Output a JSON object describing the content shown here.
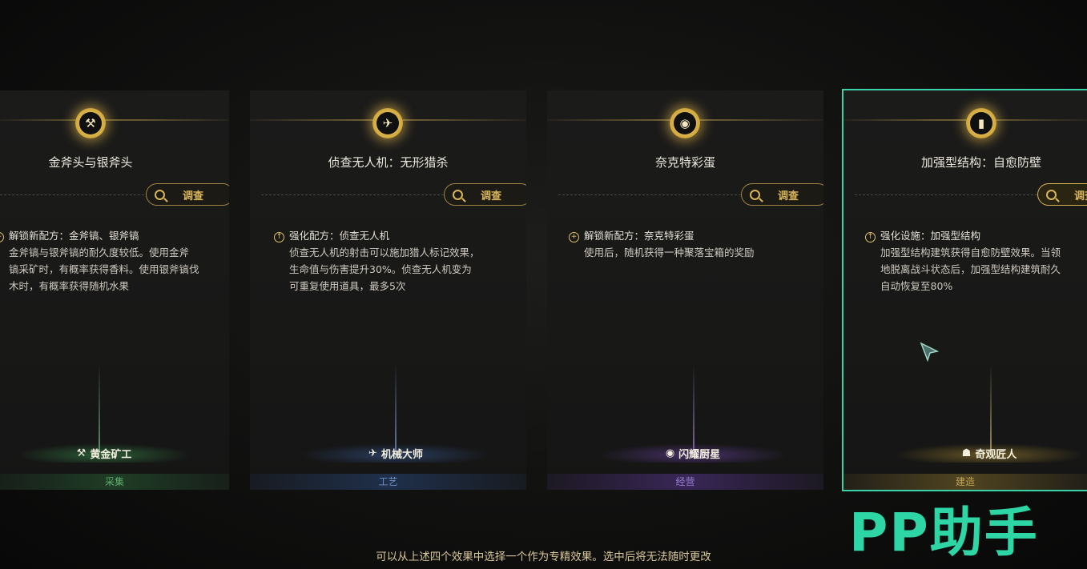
{
  "cards": [
    {
      "title": "金斧头与银斧头",
      "investigate_label": "调查",
      "effect_icon": "plus-circle-icon",
      "desc_lines": [
        "解锁新配方：金斧镐、银斧镐",
        "金斧镐与银斧镐的耐久度较低。使用金斧",
        "镐采矿时，有概率获得香料。使用银斧镐伐",
        "木时，有概率获得随机水果"
      ],
      "badge_icon": "pickaxe-icon",
      "badge": "黄金矿工",
      "category": "采集",
      "accent": "#3e8f4a"
    },
    {
      "title": "侦查无人机：无形猎杀",
      "investigate_label": "调查",
      "effect_icon": "upgrade-icon",
      "desc_lines": [
        "强化配方：侦查无人机",
        "侦查无人机的射击可以施加猎人标记效果，",
        "生命值与伤害提升30%。侦查无人机变为",
        "可重复使用道具，最多5次"
      ],
      "badge_icon": "drone-icon",
      "badge": "机械大师",
      "category": "工艺",
      "accent": "#3a5f9a"
    },
    {
      "title": "奈克特彩蛋",
      "investigate_label": "调查",
      "effect_icon": "plus-circle-icon",
      "desc_lines": [
        "解锁新配方：奈克特彩蛋",
        "使用后，随机获得一种聚落宝箱的奖励"
      ],
      "badge_icon": "dish-icon",
      "badge": "闪耀厨星",
      "category": "经营",
      "accent": "#7350a8"
    },
    {
      "title": "加强型结构：自愈防壁",
      "investigate_label": "调查",
      "effect_icon": "upgrade-icon",
      "desc_lines": [
        "强化设施：加强型结构",
        "加强型结构建筑获得自愈防壁效果。当领",
        "地脱离战斗状态后，加强型结构建筑耐久",
        "自动恢复至80%"
      ],
      "badge_icon": "builder-icon",
      "badge": "奇观匠人",
      "category": "建造",
      "accent": "#8f7a2e"
    }
  ],
  "bottom_note": "可以从上述四个效果中选择一个作为专精效果。选中后将无法随时更改",
  "watermark": "PP助手",
  "selected_card": 4
}
